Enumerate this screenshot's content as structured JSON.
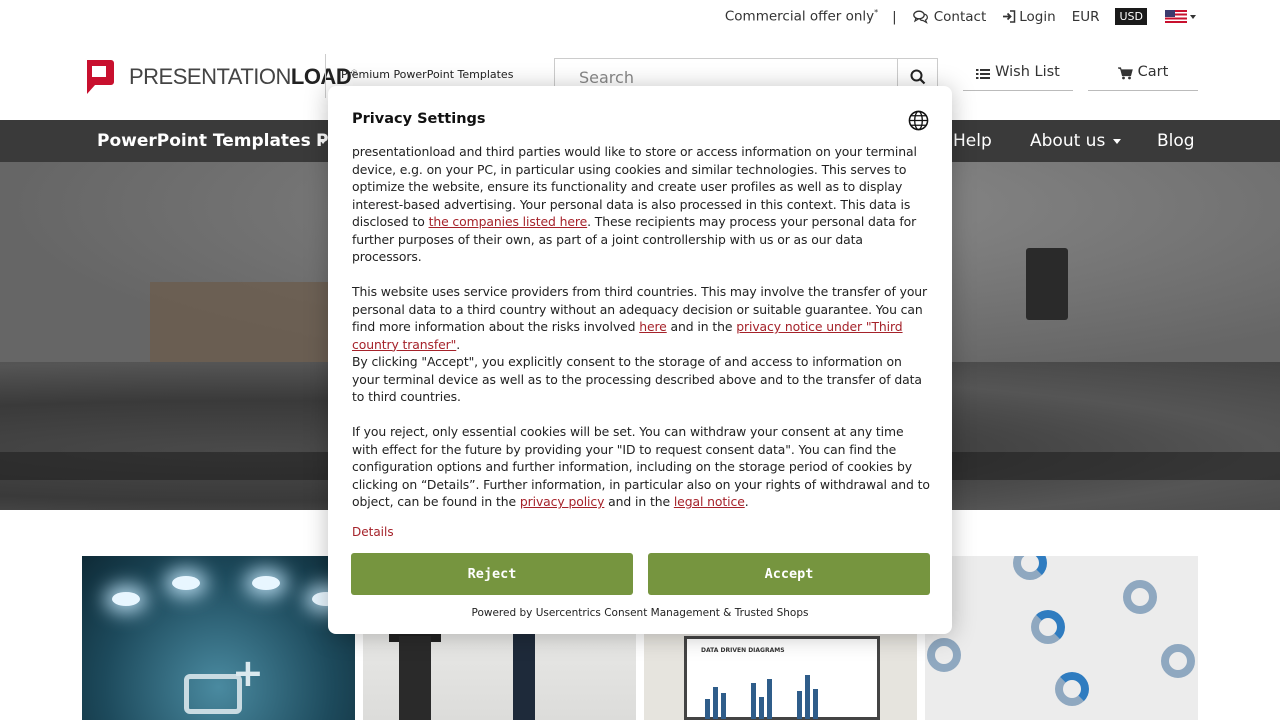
{
  "topbar": {
    "commercial": "Commercial offer only",
    "commercial_mark": "*",
    "separator": "|",
    "contact": "Contact",
    "login": "Login",
    "currency_eur": "EUR",
    "currency_usd": "USD",
    "language_icon": "us-flag-icon"
  },
  "header": {
    "logo_text_light": "PRESENTATION",
    "logo_text_bold": "LOAD",
    "logo_registered": "®",
    "tagline": "Premium PowerPoint Templates",
    "search_placeholder": "Search",
    "wish_list": "Wish List",
    "cart": "Cart",
    "brand_color": "#c8102e"
  },
  "nav": {
    "items": [
      {
        "label": "PowerPoint Templates",
        "dropdown": true
      },
      {
        "label": "P"
      },
      {
        "label": "Help"
      },
      {
        "label": "About us",
        "dropdown": true
      },
      {
        "label": "Blog"
      }
    ]
  },
  "modal": {
    "title": "Privacy Settings",
    "p1_a": "presentationload and third parties would like to store or access information on your terminal device, e.g. on your PC, in particular using cookies and similar technologies. This serves to optimize the website, ensure its functionality and create user profiles as well as to display interest-based advertising. Your personal data is also processed in this context. This data is disclosed to ",
    "p1_link": "the companies listed here",
    "p1_b": ". These recipients may process your personal data for further purposes of their own, as part of a joint controllership with us or as our data processors.",
    "p2_a": "This website uses service providers from third countries. This may involve the transfer of your personal data to a third country without an adequacy decision or suitable guarantee. You can find more information about the risks involved ",
    "p2_link1": "here",
    "p2_b": " and in the ",
    "p2_link2": "privacy notice under \"Third country transfer\"",
    "p2_c": ".",
    "p3": "By clicking \"Accept\", you explicitly consent to the storage of and access to information on your terminal device as well as to the processing described above and to the transfer of data to third countries.",
    "p4_a": "If you reject, only essential cookies will be set. You can withdraw your consent at any time with effect for the future by providing your \"ID to request consent data\". You can find the configuration options and further information, including on the storage period of cookies by clicking on “Details”. Further information, in particular also on your rights of withdrawal and to object, can be found in the ",
    "p4_link1": "privacy policy",
    "p4_b": " and in the ",
    "p4_link2": "legal notice",
    "p4_c": ".",
    "details": "Details",
    "reject": "Reject",
    "accept": "Accept",
    "powered_by": "Powered by Usercentrics Consent Management & Trusted Shops",
    "button_color": "#76953f",
    "link_color": "#a5222a"
  },
  "cards": {
    "board_title": "DATA DRIVEN DIAGRAMS"
  }
}
